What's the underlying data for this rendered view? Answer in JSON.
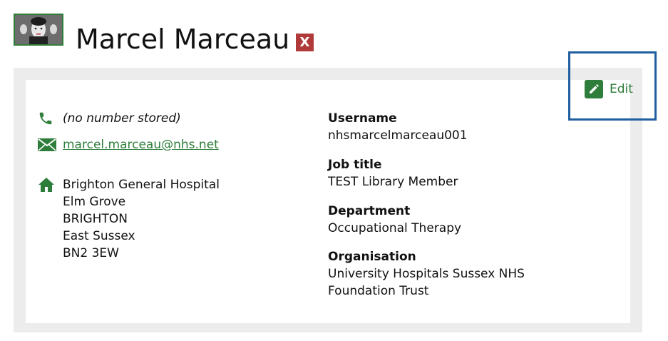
{
  "profile": {
    "name": "Marcel Marceau",
    "remove_label": "X"
  },
  "actions": {
    "edit_label": "Edit"
  },
  "contact": {
    "phone": "(no number stored)",
    "email": "marcel.marceau@nhs.net",
    "address": [
      "Brighton General Hospital",
      "Elm Grove",
      "BRIGHTON",
      "East Sussex",
      "BN2 3EW"
    ]
  },
  "details": {
    "username_label": "Username",
    "username": "nhsmarcelmarceau001",
    "job_title_label": "Job title",
    "job_title": "TEST Library Member",
    "department_label": "Department",
    "department": "Occupational Therapy",
    "organisation_label": "Organisation",
    "organisation": "University Hospitals Sussex NHS Foundation Trust"
  },
  "colors": {
    "accent_green": "#2e7d3a",
    "danger_red": "#b03a3a",
    "highlight_blue": "#1f5fa0",
    "card_border": "#ececec"
  },
  "icons": {
    "phone": "phone-icon",
    "email": "envelope-icon",
    "address": "home-icon",
    "edit": "pencil-icon"
  }
}
